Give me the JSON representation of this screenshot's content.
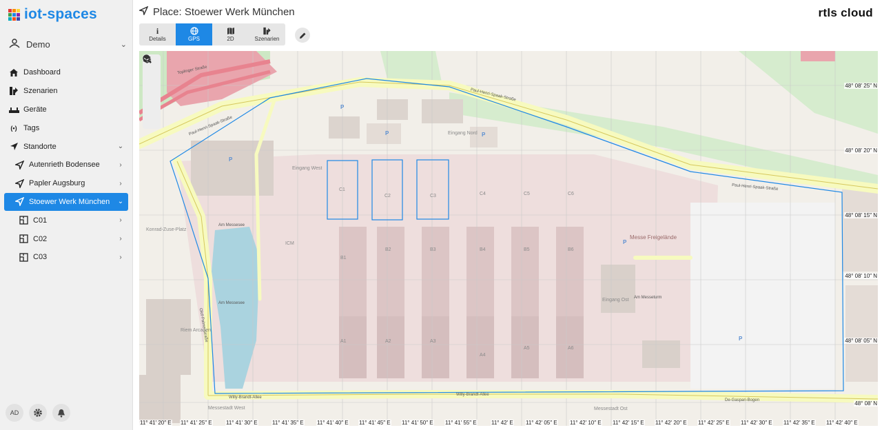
{
  "brand": {
    "name": "iot-spaces",
    "colors": [
      "#e53935",
      "#fb8c00",
      "#fdd835",
      "#43a047",
      "#1e88e5",
      "#8e24aa",
      "#00acc1",
      "#f4511e",
      "#3949ab"
    ]
  },
  "org": {
    "label": "Demo",
    "icon": "users-icon"
  },
  "nav": [
    {
      "label": "Dashboard",
      "icon": "home-icon"
    },
    {
      "label": "Szenarien",
      "icon": "scenario-icon"
    },
    {
      "label": "Geräte",
      "icon": "devices-icon"
    },
    {
      "label": "Tags",
      "icon": "tag-signal-icon"
    },
    {
      "label": "Standorte",
      "icon": "location-arrow-icon"
    }
  ],
  "places": [
    {
      "label": "Autenrieth Bodensee"
    },
    {
      "label": "Papler Augsburg"
    },
    {
      "label": "Stoewer Werk München"
    }
  ],
  "subplaces": [
    {
      "label": "C01"
    },
    {
      "label": "C02"
    },
    {
      "label": "C03"
    }
  ],
  "footer": {
    "avatar": "AD"
  },
  "header": {
    "title": "Place: Stoewer Werk München",
    "logo": "rtls cloud"
  },
  "tabs": [
    {
      "label": "Details",
      "icon": "i",
      "active": false
    },
    {
      "label": "GPS",
      "icon": "globe-icon",
      "active": true
    },
    {
      "label": "2D",
      "icon": "map-icon",
      "active": false
    },
    {
      "label": "Szenarien",
      "icon": "scenario-icon",
      "active": false
    }
  ],
  "map": {
    "lat_labels": [
      "48° 08′ 25″ N",
      "48° 08′ 20″ N",
      "48° 08′ 15″ N",
      "48° 08′ 10″ N",
      "48° 08′ 05″ N",
      "48° 08′ N"
    ],
    "lon_labels": [
      "11° 41′ 20″ E",
      "11° 41′ 25″ E",
      "11° 41′ 30″ E",
      "11° 41′ 35″ E",
      "11° 41′ 40″ E",
      "11° 41′ 45″ E",
      "11° 41′ 50″ E",
      "11° 41′ 55″ E",
      "11° 42′ E",
      "11° 42′ 05″ E",
      "11° 42′ 10″ E",
      "11° 42′ 15″ E",
      "11° 42′ 20″ E",
      "11° 42′ 25″ E",
      "11° 42′ 30″ E",
      "11° 42′ 35″ E",
      "11° 42′ 40″ E"
    ],
    "streets": [
      "Paul-Henri-Spaak-Straße",
      "Willy-Brandt-Allee",
      "Am Messesee",
      "De-Gaspari-Bogen",
      "Olof-Palme-Straße",
      "Am Messeturm",
      "Toplinger Straße"
    ],
    "areas": [
      "Messe Freigelände",
      "Eingang Nord",
      "Eingang West",
      "Eingang Ost",
      "Riem Arcaden",
      "Messestadt West",
      "Messestadt Ost",
      "Konrad-Zuse-Platz"
    ],
    "halls": [
      "C1",
      "C2",
      "C3",
      "C4",
      "C5",
      "C6",
      "B1",
      "B2",
      "B3",
      "B4",
      "B5",
      "B6",
      "A1",
      "A2",
      "A3",
      "A4",
      "A5",
      "A6",
      "ICM"
    ],
    "zoom_controls": [
      "zoom-in-icon",
      "zoom-out-icon",
      "zoom-fit-icon",
      "layers-icon"
    ]
  }
}
